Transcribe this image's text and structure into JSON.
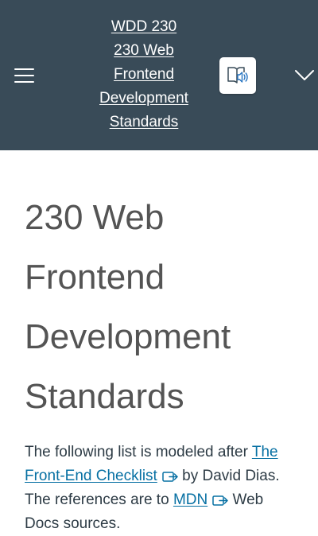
{
  "header": {
    "menu_icon": "hamburger-menu-icon",
    "title_lines": [
      "WDD 230",
      "230 Web",
      "Frontend",
      "Development",
      "Standards"
    ],
    "immersive_reader_icon": "immersive-reader-icon",
    "expand_icon": "chevron-down-icon"
  },
  "colors": {
    "header_bg": "#394b58",
    "link": "#0770a3",
    "title_text": "#545454",
    "body_text": "#2d3b45"
  },
  "page": {
    "title_lines": [
      "230 Web",
      "Frontend",
      "Development",
      "Standards"
    ],
    "intro": {
      "text_1": "The following list is modeled after ",
      "link_1": "The Front-End Checklist",
      "text_2": " by David Dias. The references are to ",
      "link_2": "MDN",
      "text_3": " Web Docs sources.",
      "external_link_icon": "external-link-icon"
    }
  }
}
